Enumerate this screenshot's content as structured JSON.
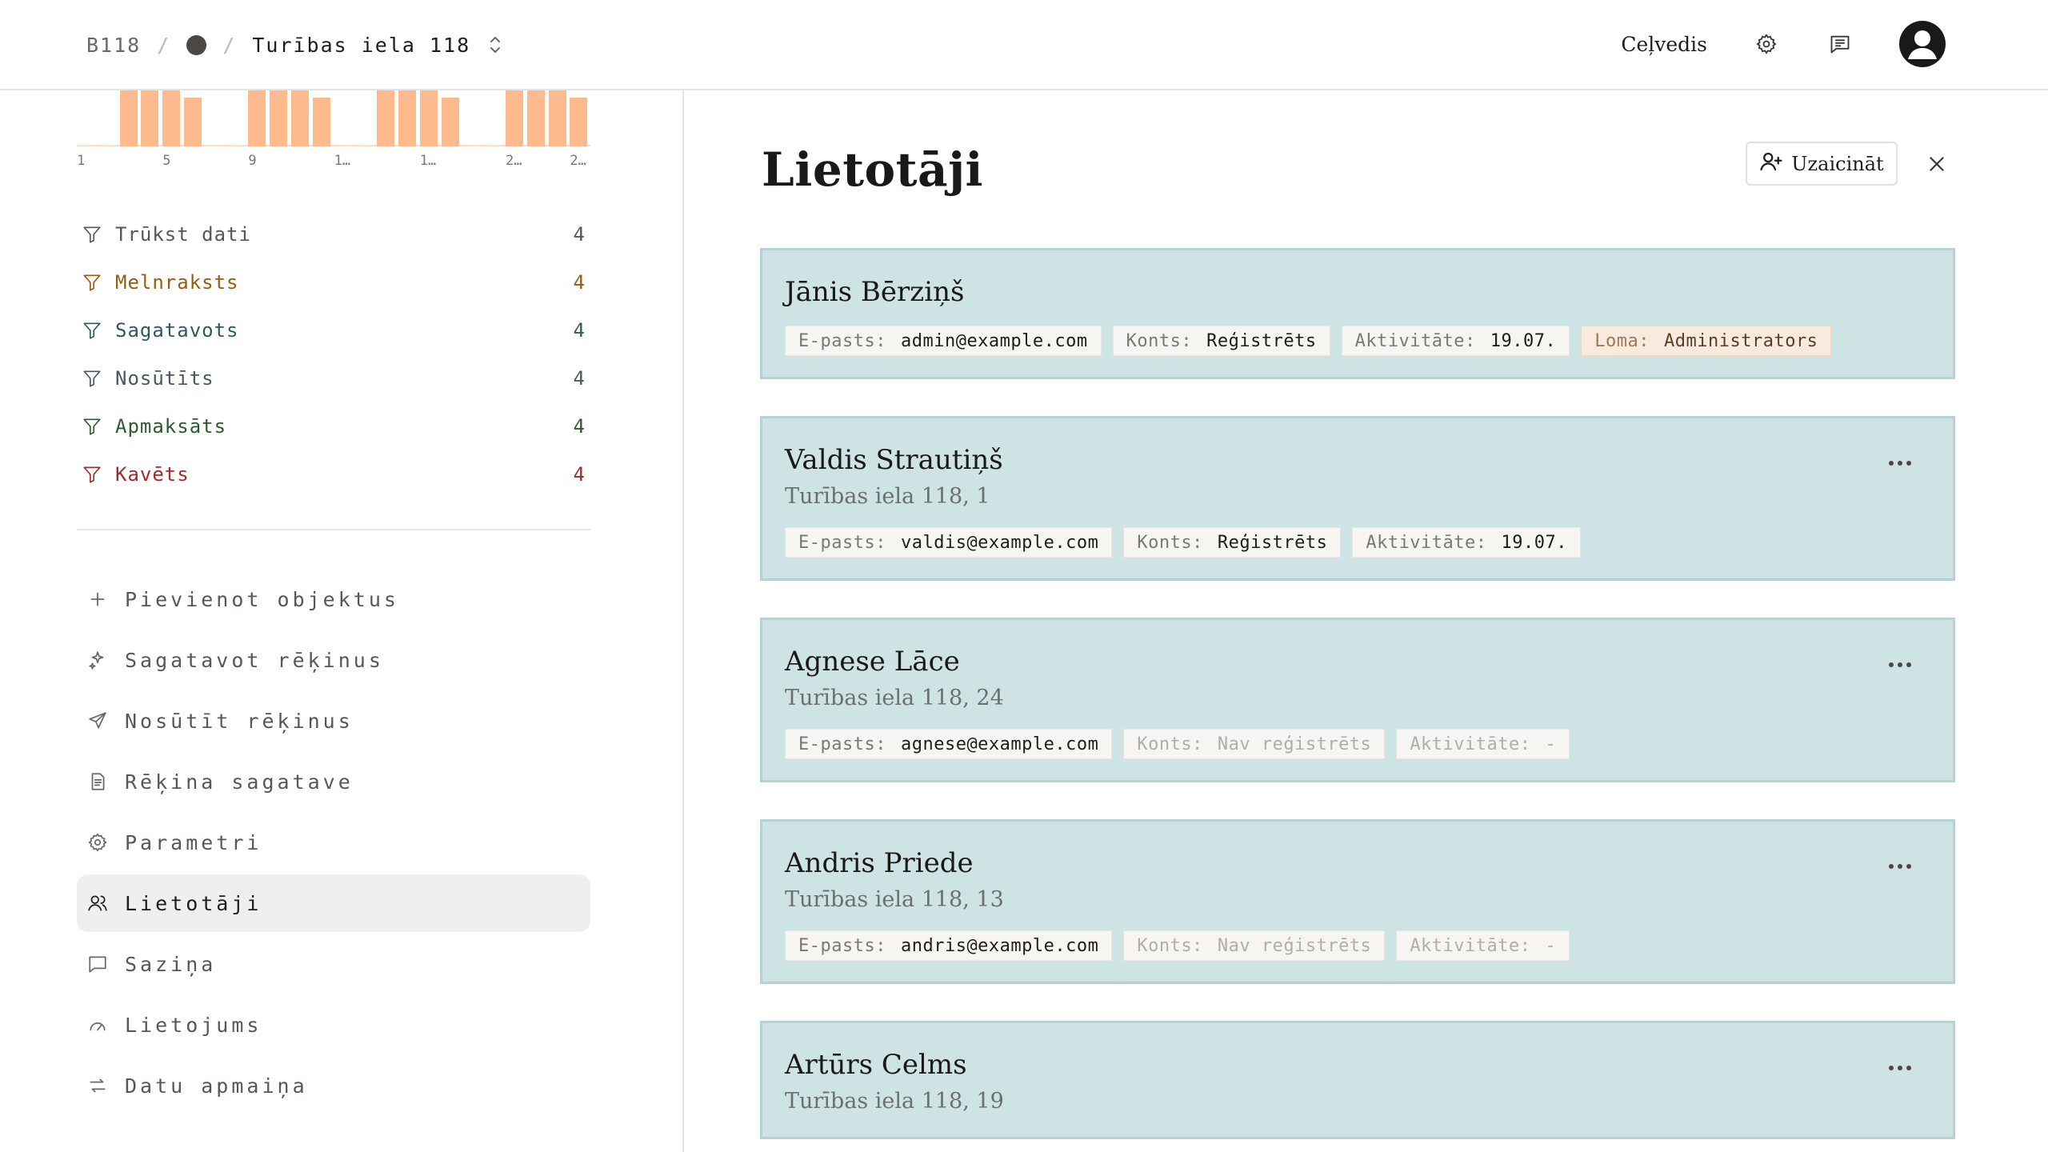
{
  "header": {
    "code": "B118",
    "separator": "/",
    "title": "Turības iela 118",
    "guide": "Ceļvedis"
  },
  "histogram": {
    "ticks": [
      "1",
      "5",
      "9",
      "1…",
      "1…",
      "2…",
      "2…"
    ],
    "values": [
      0,
      0,
      1,
      1,
      1,
      0.85,
      0,
      0,
      1,
      1,
      1,
      0.85,
      0,
      0,
      1,
      1,
      1,
      0.85,
      0,
      0,
      1,
      1,
      1,
      0.85
    ],
    "color": "#fdba8c"
  },
  "filters": [
    {
      "label": "Trūkst dati",
      "count": "4",
      "color": "#5a5651"
    },
    {
      "label": "Melnraksts",
      "count": "4",
      "color": "#9a5a12"
    },
    {
      "label": "Sagatavots",
      "count": "4",
      "color": "#2f5a5c"
    },
    {
      "label": "Nosūtīts",
      "count": "4",
      "color": "#4a5660"
    },
    {
      "label": "Apmaksāts",
      "count": "4",
      "color": "#2e5a2e"
    },
    {
      "label": "Kavēts",
      "count": "4",
      "color": "#a32a2a"
    }
  ],
  "nav": [
    {
      "label": "Pievienot objektus",
      "icon": "plus-icon"
    },
    {
      "label": "Sagatavot rēķinus",
      "icon": "sparkle-icon"
    },
    {
      "label": "Nosūtīt rēķinus",
      "icon": "send-icon"
    },
    {
      "label": "Rēķina sagatave",
      "icon": "document-icon"
    },
    {
      "label": "Parametri",
      "icon": "gear-icon"
    },
    {
      "label": "Lietotāji",
      "icon": "users-icon",
      "active": true
    },
    {
      "label": "Saziņa",
      "icon": "chat-icon"
    },
    {
      "label": "Lietojums",
      "icon": "gauge-icon"
    },
    {
      "label": "Datu apmaiņa",
      "icon": "exchange-icon"
    }
  ],
  "main": {
    "title": "Lietotāji",
    "invite_label": "Uzaicināt"
  },
  "users": [
    {
      "name": "Jānis Bērziņš",
      "address": "",
      "chips": [
        {
          "key": "E-pasts:",
          "value": "admin@example.com",
          "style": "normal"
        },
        {
          "key": "Konts:",
          "value": "Reģistrēts",
          "style": "normal"
        },
        {
          "key": "Aktivitāte:",
          "value": "19.07.",
          "style": "normal"
        },
        {
          "key": "Loma:",
          "value": "Administrators",
          "style": "role"
        }
      ],
      "menu": false
    },
    {
      "name": "Valdis Strautiņš",
      "address": "Turības iela 118, 1",
      "chips": [
        {
          "key": "E-pasts:",
          "value": "valdis@example.com",
          "style": "normal"
        },
        {
          "key": "Konts:",
          "value": "Reģistrēts",
          "style": "normal"
        },
        {
          "key": "Aktivitāte:",
          "value": "19.07.",
          "style": "normal"
        }
      ],
      "menu": true
    },
    {
      "name": "Agnese Lāce",
      "address": "Turības iela 118, 24",
      "chips": [
        {
          "key": "E-pasts:",
          "value": "agnese@example.com",
          "style": "normal"
        },
        {
          "key": "Konts:",
          "value": "Nav reģistrēts",
          "style": "dim"
        },
        {
          "key": "Aktivitāte:",
          "value": "-",
          "style": "dim"
        }
      ],
      "menu": true
    },
    {
      "name": "Andris Priede",
      "address": "Turības iela 118, 13",
      "chips": [
        {
          "key": "E-pasts:",
          "value": "andris@example.com",
          "style": "normal"
        },
        {
          "key": "Konts:",
          "value": "Nav reģistrēts",
          "style": "dim"
        },
        {
          "key": "Aktivitāte:",
          "value": "-",
          "style": "dim"
        }
      ],
      "menu": true
    },
    {
      "name": "Artūrs Celms",
      "address": "Turības iela 118, 19",
      "chips": [],
      "menu": true
    }
  ]
}
